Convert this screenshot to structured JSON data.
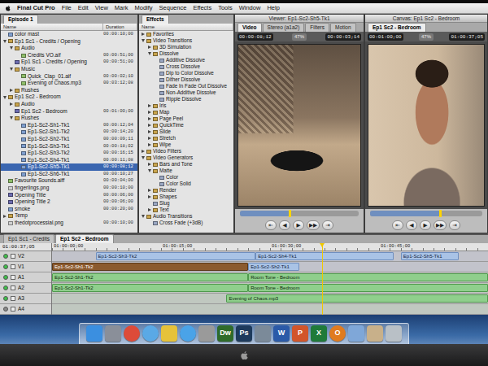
{
  "menu_bar": {
    "app": "Final Cut Pro",
    "items": [
      "File",
      "Edit",
      "View",
      "Mark",
      "Modify",
      "Sequence",
      "Effects",
      "Tools",
      "Window",
      "Help"
    ]
  },
  "browser": {
    "tabs": [
      {
        "label": "Episode 1",
        "selected": true
      }
    ],
    "columns": [
      "Name",
      "Duration"
    ],
    "items": [
      {
        "name": "color mast",
        "kind": "clip",
        "duration": "00:00:10;00",
        "selected": false
      },
      {
        "name": "Ep1 Sc1 - Credits / Opening",
        "kind": "bin",
        "expanded": true,
        "selected": false,
        "children": [
          {
            "name": "Audio",
            "kind": "bin",
            "expanded": true,
            "selected": false,
            "children": [
              {
                "name": "Credits VO.aif",
                "kind": "audio",
                "duration": "00:00:51;00",
                "selected": false
              }
            ]
          },
          {
            "name": "Ep1 Sc1 - Credits / Opening",
            "kind": "sequence",
            "duration": "00:00:51;00",
            "selected": false
          },
          {
            "name": "Music",
            "kind": "bin",
            "expanded": true,
            "selected": false,
            "children": [
              {
                "name": "Quick_Clap_01.aif",
                "kind": "audio",
                "duration": "00:00:02;10",
                "selected": false
              },
              {
                "name": "Evening of Chaos.mp3",
                "kind": "audio",
                "duration": "00:03:12;08",
                "selected": false
              }
            ]
          },
          {
            "name": "Rushes",
            "kind": "bin",
            "expanded": false,
            "selected": false
          }
        ]
      },
      {
        "name": "Ep1 Sc2 - Bedroom",
        "kind": "bin",
        "expanded": true,
        "selected": false,
        "children": [
          {
            "name": "Audio",
            "kind": "bin",
            "expanded": false,
            "selected": false
          },
          {
            "name": "Ep1 Sc2 - Bedroom",
            "kind": "sequence",
            "duration": "00:01:00;00",
            "selected": false
          },
          {
            "name": "Rushes",
            "kind": "bin",
            "expanded": true,
            "selected": false,
            "children": [
              {
                "name": "Ep1-Sc2-Sh1-Tk1",
                "kind": "clip",
                "duration": "00:00:12;04",
                "selected": false
              },
              {
                "name": "Ep1-Sc2-Sh1-Tk2",
                "kind": "clip",
                "duration": "00:00:14;20",
                "selected": false
              },
              {
                "name": "Ep1-Sc2-Sh2-Tk1",
                "kind": "clip",
                "duration": "00:00:09;11",
                "selected": false
              },
              {
                "name": "Ep1-Sc2-Sh3-Tk1",
                "kind": "clip",
                "duration": "00:00:18;02",
                "selected": false
              },
              {
                "name": "Ep1-Sc2-Sh3-Tk2",
                "kind": "clip",
                "duration": "00:00:16;15",
                "selected": false
              },
              {
                "name": "Ep1-Sc2-Sh4-Tk1",
                "kind": "clip",
                "duration": "00:00:11;08",
                "selected": false
              },
              {
                "name": "Ep1-Sc2-Sh5-Tk1",
                "kind": "clip",
                "duration": "00:00:08;12",
                "selected": true
              },
              {
                "name": "Ep1-Sc2-Sh6-Tk1",
                "kind": "clip",
                "duration": "00:00:10;27",
                "selected": false
              }
            ]
          }
        ]
      },
      {
        "name": "Favourite Sounds.aiff",
        "kind": "audio",
        "duration": "00:00:04;00",
        "selected": false
      },
      {
        "name": "fingerlings.png",
        "kind": "still",
        "duration": "00:00:10;00",
        "selected": false
      },
      {
        "name": "Opening Title",
        "kind": "sequence",
        "duration": "00:00:06;00",
        "selected": false
      },
      {
        "name": "Opening Title 2",
        "kind": "sequence",
        "duration": "00:00:06;00",
        "selected": false
      },
      {
        "name": "smoke",
        "kind": "clip",
        "duration": "00:00:20;00",
        "selected": false
      },
      {
        "name": "Temp",
        "kind": "bin",
        "expanded": false,
        "selected": false
      },
      {
        "name": "thedotprocessial.png",
        "kind": "still",
        "duration": "00:00:10;00",
        "selected": false
      }
    ]
  },
  "effects": {
    "tabs": [
      {
        "label": "Effects",
        "selected": true
      }
    ],
    "columns": [
      "Name"
    ],
    "items": [
      {
        "name": "Favorites",
        "kind": "bin",
        "expanded": false
      },
      {
        "name": "Video Transitions",
        "kind": "bin",
        "expanded": true,
        "children": [
          {
            "name": "3D Simulation",
            "kind": "bin",
            "expanded": false
          },
          {
            "name": "Dissolve",
            "kind": "bin",
            "expanded": true,
            "children": [
              {
                "name": "Additive Dissolve",
                "kind": "item"
              },
              {
                "name": "Cross Dissolve",
                "kind": "item"
              },
              {
                "name": "Dip to Color Dissolve",
                "kind": "item"
              },
              {
                "name": "Dither Dissolve",
                "kind": "item"
              },
              {
                "name": "Fade In Fade Out Dissolve",
                "kind": "item"
              },
              {
                "name": "Non-Additive Dissolve",
                "kind": "item"
              },
              {
                "name": "Ripple Dissolve",
                "kind": "item"
              }
            ]
          },
          {
            "name": "Iris",
            "kind": "bin",
            "expanded": false
          },
          {
            "name": "Map",
            "kind": "bin",
            "expanded": false
          },
          {
            "name": "Page Peel",
            "kind": "bin",
            "expanded": false
          },
          {
            "name": "QuickTime",
            "kind": "bin",
            "expanded": false
          },
          {
            "name": "Slide",
            "kind": "bin",
            "expanded": false
          },
          {
            "name": "Stretch",
            "kind": "bin",
            "expanded": false
          },
          {
            "name": "Wipe",
            "kind": "bin",
            "expanded": false
          }
        ]
      },
      {
        "name": "Video Filters",
        "kind": "bin",
        "expanded": false
      },
      {
        "name": "Video Generators",
        "kind": "bin",
        "expanded": true,
        "children": [
          {
            "name": "Bars and Tone",
            "kind": "bin",
            "expanded": false
          },
          {
            "name": "Matte",
            "kind": "bin",
            "expanded": true,
            "children": [
              {
                "name": "Color",
                "kind": "item"
              },
              {
                "name": "Color Solid",
                "kind": "item"
              }
            ]
          },
          {
            "name": "Render",
            "kind": "bin",
            "expanded": false
          },
          {
            "name": "Shapes",
            "kind": "bin",
            "expanded": false
          },
          {
            "name": "Slug",
            "kind": "item"
          },
          {
            "name": "Text",
            "kind": "bin",
            "expanded": false
          }
        ]
      },
      {
        "name": "Audio Transitions",
        "kind": "bin",
        "expanded": true,
        "children": [
          {
            "name": "Cross Fade (+3dB)",
            "kind": "item"
          }
        ]
      }
    ]
  },
  "viewer": {
    "title": "Viewer: Ep1-Sc2-Sh5-Tk1",
    "tabs": [
      {
        "label": "Video",
        "selected": true
      },
      {
        "label": "Stereo (a1a2)",
        "selected": false
      },
      {
        "label": "Filters",
        "selected": false
      },
      {
        "label": "Motion",
        "selected": false
      }
    ],
    "duration": "00:00:08;12",
    "zoom": "47%",
    "timecode": "00:00:03;14",
    "position": {
      "level": 0.42
    },
    "controls": [
      "⇤",
      "◀",
      "▶",
      "▶▶",
      "⇥"
    ]
  },
  "canvas": {
    "title": "Canvas: Ep1 Sc2 - Bedroom",
    "tabs": [
      {
        "label": "Ep1 Sc2 - Bedroom",
        "selected": true
      }
    ],
    "duration": "00:01:00;00",
    "zoom": "47%",
    "timecode": "01:00:37;05",
    "position": {
      "level": 0.62
    },
    "controls": [
      "⇤",
      "◀",
      "▶",
      "▶▶",
      "⇥"
    ]
  },
  "timeline": {
    "tabs": [
      {
        "label": "Ep1 Sc1 - Credits",
        "selected": false
      },
      {
        "label": "Ep1 Sc2 - Bedroom",
        "selected": true
      }
    ],
    "timecode": "01:00:37;05",
    "ruler": [
      "01:00:00;00",
      "01:00:15;00",
      "01:00:30;00",
      "01:00:45;00"
    ],
    "length": 60,
    "playhead": {
      "level": 0.62
    },
    "tracks": [
      {
        "label": "V2",
        "kind": "video",
        "enabled": true,
        "clips": [
          {
            "name": "Ep1-Sc2-Sh3-Tk2",
            "start": 6,
            "end": 28,
            "selected": false
          },
          {
            "name": "Ep1-Sc2-Sh4-Tk1",
            "start": 28,
            "end": 47,
            "selected": false
          },
          {
            "name": "Ep1-Sc2-Sh5-Tk1",
            "start": 48,
            "end": 56,
            "selected": false
          }
        ]
      },
      {
        "label": "V1",
        "kind": "video",
        "enabled": true,
        "clips": [
          {
            "name": "Ep1-Sc2-Sh1-Tk2",
            "start": 0,
            "end": 27,
            "selected": true
          },
          {
            "name": "Ep1-Sc2-Sh2-Tk1",
            "start": 27,
            "end": 34,
            "selected": false
          }
        ]
      },
      {
        "label": "A1",
        "kind": "audio",
        "enabled": true,
        "clips": [
          {
            "name": "Ep1-Sc2-Sh1-Tk2",
            "start": 0,
            "end": 27,
            "selected": false
          },
          {
            "name": "Room Tone - Bedroom",
            "start": 27,
            "end": 60,
            "selected": false
          }
        ]
      },
      {
        "label": "A2",
        "kind": "audio",
        "enabled": true,
        "clips": [
          {
            "name": "Ep1-Sc2-Sh1-Tk2",
            "start": 0,
            "end": 27,
            "selected": false
          },
          {
            "name": "Room Tone - Bedroom",
            "start": 27,
            "end": 60,
            "selected": false
          }
        ]
      },
      {
        "label": "A3",
        "kind": "audio",
        "enabled": true,
        "clips": [
          {
            "name": "Evening of Chaos.mp3",
            "start": 24,
            "end": 60,
            "selected": false
          }
        ]
      },
      {
        "label": "A4",
        "kind": "audio",
        "enabled": false,
        "clips": []
      }
    ]
  },
  "dock": {
    "items": [
      {
        "kind": "square",
        "color": "#3b8fe0"
      },
      {
        "kind": "square",
        "color": "#8a8f99"
      },
      {
        "kind": "round",
        "color": "#dd4b39"
      },
      {
        "kind": "round",
        "color": "#5aa9e6"
      },
      {
        "kind": "square",
        "color": "#e6c23a"
      },
      {
        "kind": "round",
        "color": "#4aa3e8"
      },
      {
        "kind": "square",
        "color": "#9a9a9a"
      },
      {
        "kind": "square",
        "color": "#2f6b2a",
        "label": "Dw"
      },
      {
        "kind": "square",
        "color": "#1d3a5c",
        "label": "Ps"
      },
      {
        "kind": "square",
        "color": "#7b8a99"
      },
      {
        "kind": "square",
        "color": "#2b5aa8",
        "label": "W"
      },
      {
        "kind": "square",
        "color": "#d2552a",
        "label": "P"
      },
      {
        "kind": "square",
        "color": "#1f7a3a",
        "label": "X"
      },
      {
        "kind": "round",
        "color": "#e07b1f",
        "label": "O"
      },
      {
        "kind": "square",
        "color": "#7fa7d8"
      },
      {
        "kind": "square",
        "color": "#c8b08a"
      },
      {
        "kind": "square",
        "color": "#b9c0c6"
      }
    ]
  }
}
